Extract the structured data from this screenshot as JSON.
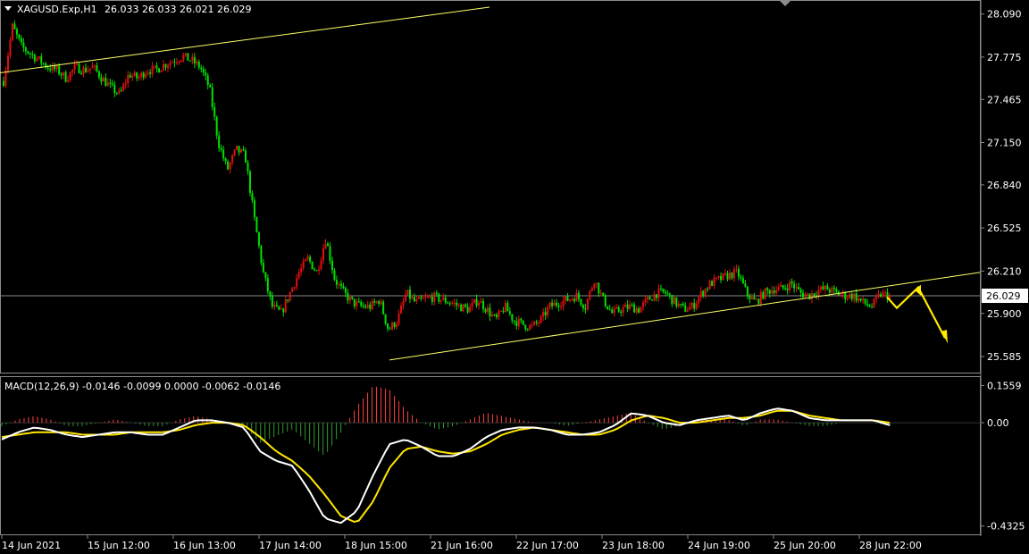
{
  "header": {
    "symbol_tf": "XAGUSD.Exp,H1",
    "ohlc": "26.033 26.033 26.021 26.029"
  },
  "macd_header": "MACD(12,26,9) -0.0146 -0.0099 0.0000 -0.0062 -0.0146",
  "price_panel": {
    "y_ticks": [
      "28.090",
      "27.775",
      "27.465",
      "27.150",
      "26.840",
      "26.525",
      "26.210",
      "25.900",
      "25.585"
    ],
    "y_range": [
      25.5,
      28.14
    ],
    "current_price": "26.029",
    "current_price_value": 26.029
  },
  "macd_panel": {
    "y_ticks": [
      "0.1559",
      "0.00",
      "-0.4325"
    ],
    "y_range": [
      -0.46,
      0.18
    ]
  },
  "x_ticks": [
    "14 Jun 2021",
    "15 Jun 12:00",
    "16 Jun 13:00",
    "17 Jun 14:00",
    "18 Jun 15:00",
    "21 Jun 16:00",
    "22 Jun 17:00",
    "23 Jun 18:00",
    "24 Jun 19:00",
    "25 Jun 20:00",
    "28 Jun 22:00"
  ],
  "colors": {
    "background": "#000000",
    "bull": "#e01010",
    "bear": "#00e000",
    "trendline": "#ffff66",
    "arrow": "#ffea00",
    "macd_main": "#ffffff",
    "macd_signal": "#ffe600",
    "hist_pos": "#ff4040",
    "hist_neg": "#2f9a2f",
    "grid": "#888888"
  },
  "chart_data": [
    {
      "type": "candlestick",
      "title": "XAGUSD.Exp,H1",
      "x_ticks": [
        "14 Jun 2021",
        "15 Jun 12:00",
        "16 Jun 13:00",
        "17 Jun 14:00",
        "18 Jun 15:00",
        "21 Jun 16:00",
        "22 Jun 17:00",
        "23 Jun 18:00",
        "24 Jun 19:00",
        "25 Jun 20:00",
        "28 Jun 22:00"
      ],
      "ylim": [
        25.5,
        28.14
      ],
      "close_path": [
        27.6,
        28.0,
        27.85,
        27.8,
        27.75,
        27.7,
        27.68,
        27.62,
        27.7,
        27.68,
        27.7,
        27.62,
        27.55,
        27.5,
        27.65,
        27.62,
        27.68,
        27.68,
        27.72,
        27.75,
        27.78,
        27.75,
        27.7,
        27.55,
        27.15,
        26.95,
        27.1,
        27.05,
        26.6,
        26.2,
        25.95,
        25.9,
        26.05,
        26.2,
        26.3,
        26.2,
        26.45,
        26.15,
        26.05,
        25.98,
        25.95,
        25.95,
        26.0,
        25.78,
        25.85,
        26.05,
        25.98,
        26.0,
        26.02,
        26.0,
        25.98,
        25.95,
        25.93,
        26.0,
        25.93,
        25.85,
        25.95,
        25.85,
        25.82,
        25.8,
        25.85,
        25.95,
        25.98,
        26.0,
        26.03,
        25.95,
        26.15,
        26.0,
        25.9,
        25.93,
        25.95,
        25.93,
        26.0,
        26.05,
        26.05,
        25.98,
        25.93,
        25.95,
        26.05,
        26.12,
        26.15,
        26.18,
        26.2,
        26.05,
        25.98,
        26.05,
        26.08,
        26.08,
        26.12,
        26.05,
        26.03,
        26.07,
        26.08,
        26.05,
        26.03,
        26.03,
        25.98,
        25.95,
        26.04,
        26.029
      ],
      "horizontal_line": 26.029,
      "trendlines": [
        {
          "from": [
            "start",
            27.66
          ],
          "to": [
            "16 Jun",
            27.8
          ],
          "extends_up": true
        },
        {
          "from": [
            "18 Jun",
            25.56
          ],
          "to": [
            "after 28 Jun",
            26.2
          ]
        }
      ]
    },
    {
      "type": "line",
      "title": "MACD(12,26,9)",
      "ylim": [
        -0.46,
        0.18
      ],
      "series": [
        {
          "name": "MACD",
          "values": [
            -0.07,
            -0.04,
            -0.02,
            -0.03,
            -0.05,
            -0.06,
            -0.05,
            -0.04,
            -0.04,
            -0.05,
            -0.05,
            -0.02,
            0.01,
            0.01,
            0.0,
            -0.02,
            -0.12,
            -0.16,
            -0.18,
            -0.28,
            -0.4,
            -0.42,
            -0.37,
            -0.22,
            -0.09,
            -0.07,
            -0.1,
            -0.14,
            -0.14,
            -0.11,
            -0.06,
            -0.03,
            -0.02,
            -0.02,
            -0.03,
            -0.05,
            -0.05,
            -0.04,
            -0.01,
            0.04,
            0.03,
            0.0,
            -0.01,
            0.01,
            0.02,
            0.03,
            0.01,
            0.04,
            0.06,
            0.05,
            0.02,
            0.01,
            0.01,
            0.01,
            0.01,
            -0.01
          ]
        },
        {
          "name": "Signal",
          "values": [
            -0.06,
            -0.05,
            -0.04,
            -0.04,
            -0.04,
            -0.05,
            -0.05,
            -0.05,
            -0.04,
            -0.04,
            -0.04,
            -0.03,
            -0.01,
            0.0,
            0.0,
            -0.01,
            -0.06,
            -0.12,
            -0.16,
            -0.22,
            -0.3,
            -0.39,
            -0.42,
            -0.33,
            -0.19,
            -0.11,
            -0.1,
            -0.12,
            -0.13,
            -0.12,
            -0.09,
            -0.05,
            -0.03,
            -0.02,
            -0.03,
            -0.04,
            -0.05,
            -0.05,
            -0.03,
            0.01,
            0.03,
            0.02,
            0.0,
            0.0,
            0.01,
            0.02,
            0.02,
            0.03,
            0.05,
            0.05,
            0.03,
            0.02,
            0.01,
            0.01,
            0.01,
            0.0
          ]
        }
      ]
    }
  ]
}
